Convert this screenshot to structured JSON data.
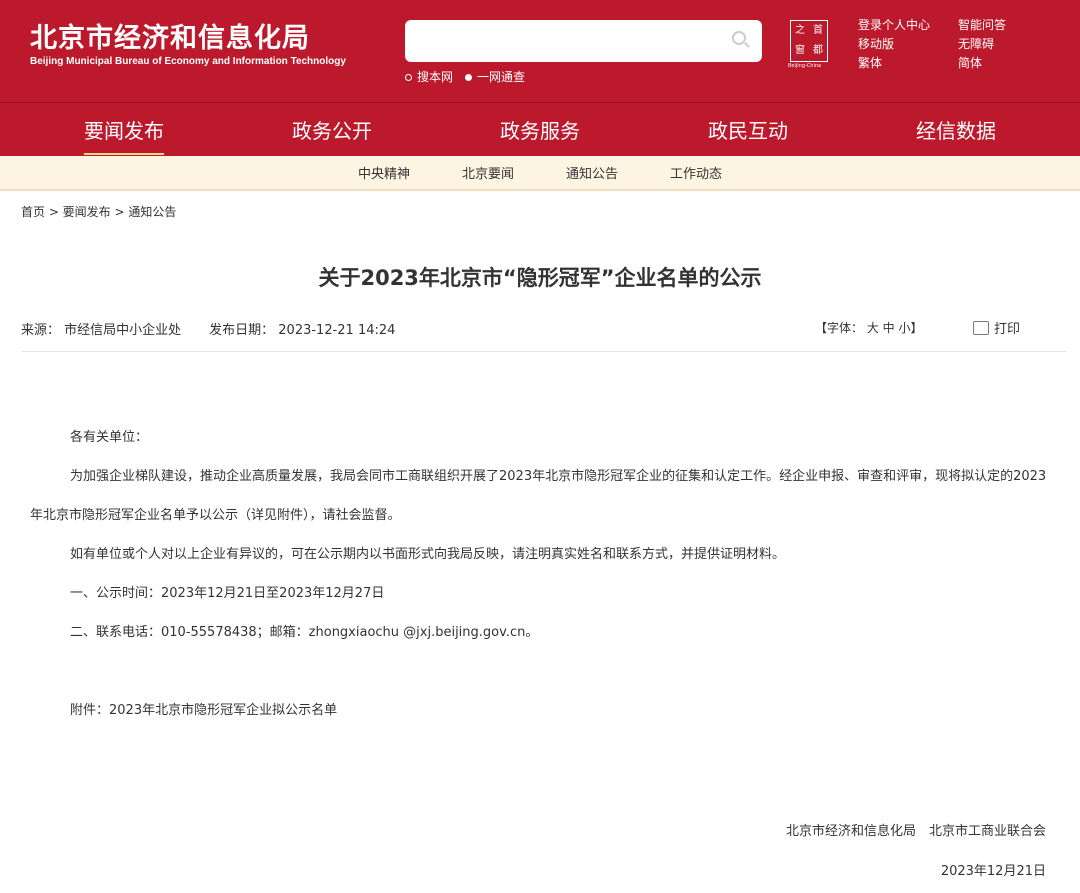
{
  "header": {
    "title_cn": "北京市经济和信息化局",
    "title_en": "Beijing Municipal Bureau of Economy and Information Technology",
    "search_placeholder": "",
    "search_options": [
      "搜本网",
      "一网通查"
    ],
    "seal": [
      "之",
      "首",
      "窗",
      "都"
    ],
    "seal_en": "Beijing-China",
    "links": [
      "登录个人中心",
      "智能问答",
      "移动版",
      "无障碍",
      "繁体",
      "简体"
    ]
  },
  "nav": [
    "要闻发布",
    "政务公开",
    "政务服务",
    "政民互动",
    "经信数据"
  ],
  "subnav": [
    "中央精神",
    "北京要闻",
    "通知公告",
    "工作动态"
  ],
  "breadcrumb": "首页 > 要闻发布 > 通知公告",
  "article": {
    "title": "关于2023年北京市“隐形冠军”企业名单的公示",
    "source": "来源： 市经信局中小企业处",
    "date": "发布日期： 2023-12-21 14:24",
    "font_size": "【字体： 大 中 小】",
    "print": "打印",
    "paragraphs": [
      "各有关单位：",
      "为加强企业梯队建设，推动企业高质量发展，我局会同市工商联组织开展了2023年北京市隐形冠军企业的征集和认定工作。经企业申报、审查和评审，现将拟认定的2023年北京市隐形冠军企业名单予以公示（详见附件），请社会监督。",
      "如有单位或个人对以上企业有异议的，可在公示期内以书面形式向我局反映，请注明真实姓名和联系方式，并提供证明材料。",
      "一、公示时间：2023年12月21日至2023年12月27日",
      "二、联系电话：010-55578438；邮箱：zhongxiaochu @jxj.beijing.gov.cn。"
    ],
    "attachment": "附件：2023年北京市隐形冠军企业拟公示名单",
    "signature": "北京市经济和信息化局　北京市工商业联合会",
    "sign_date": "2023年12月21日"
  }
}
